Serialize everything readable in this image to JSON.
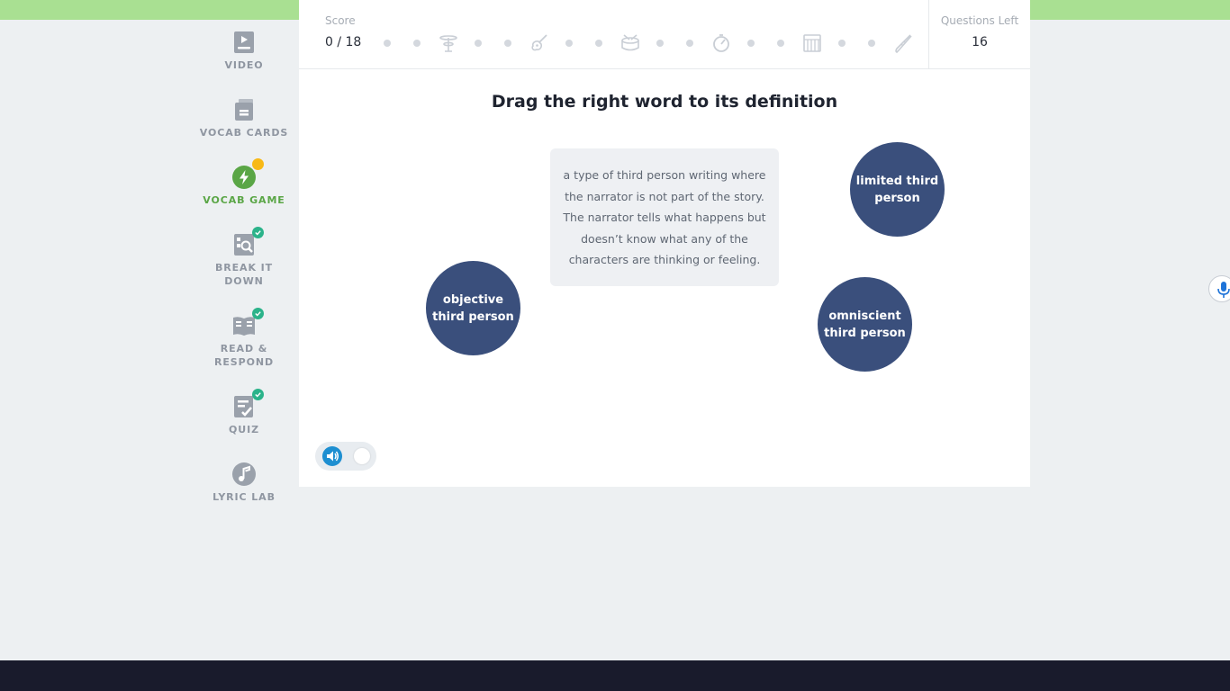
{
  "sidebar": {
    "items": [
      {
        "label": "VIDEO",
        "icon": "video-icon",
        "active": false,
        "completed": false
      },
      {
        "label": "VOCAB CARDS",
        "icon": "vocab-cards-icon",
        "active": false,
        "completed": false
      },
      {
        "label": "VOCAB GAME",
        "icon": "lightning-icon",
        "active": true,
        "completed": false
      },
      {
        "label": "BREAK IT DOWN",
        "icon": "magnify-grid-icon",
        "active": false,
        "completed": true
      },
      {
        "label": "READ & RESPOND",
        "icon": "open-book-icon",
        "active": false,
        "completed": true
      },
      {
        "label": "QUIZ",
        "icon": "quiz-icon",
        "active": false,
        "completed": true
      },
      {
        "label": "LYRIC LAB",
        "icon": "music-note-icon",
        "active": false,
        "completed": false
      }
    ]
  },
  "score": {
    "label": "Score",
    "value": "0 / 18"
  },
  "progress_icons": [
    "drum-cymbal-icon",
    "guitar-icon",
    "drum-icon",
    "timer-icon",
    "keyboard-icon",
    "saxophone-icon"
  ],
  "questions_left": {
    "label": "Questions Left",
    "value": "16"
  },
  "game": {
    "title": "Drag the right word to its definition",
    "definition": "a type of third person writing where the narrator is not part of the story. The narrator tells what happens but doesn’t know what any of the characters are thinking or feeling.",
    "choices": [
      "limited third person",
      "objective third person",
      "omniscient third person"
    ]
  },
  "colors": {
    "accent_green": "#5aa646",
    "bubble": "#3a4f7c",
    "check": "#2bb38a",
    "notification": "#f8b916",
    "top_band": "#a9e092",
    "bottom_band": "#191b2c"
  }
}
